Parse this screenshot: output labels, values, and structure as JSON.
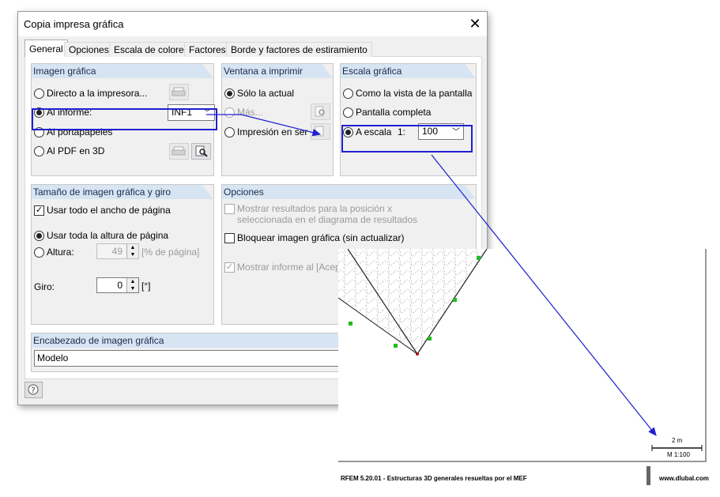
{
  "dialog": {
    "title": "Copia impresa gráfica",
    "tabs": [
      "General",
      "Opciones",
      "Escala de colores",
      "Factores",
      "Borde y factores de estiramiento"
    ],
    "active_tab": "General"
  },
  "imagen_grafica": {
    "header": "Imagen gráfica",
    "options": [
      "Directo a la impresora...",
      "Al informe:",
      "Al portapapeles",
      "Al PDF en 3D"
    ],
    "selected": "Al informe:",
    "report_value": "INF1"
  },
  "ventana": {
    "header": "Ventana a imprimir",
    "options": [
      "Sólo la actual",
      "Más...",
      "Impresión en serie..."
    ],
    "selected": "Sólo la actual"
  },
  "escala": {
    "header": "Escala gráfica",
    "options": [
      "Como la vista de la pantalla",
      "Pantalla completa",
      "A escala"
    ],
    "selected": "A escala",
    "ratio_label": "1:",
    "scale_value": "100"
  },
  "tamano": {
    "header": "Tamaño de imagen gráfica y giro",
    "use_width_label": "Usar todo el ancho de página",
    "use_height_label": "Usar toda la altura de página",
    "height_label": "Altura:",
    "height_value": "49",
    "height_unit": "[% de página]",
    "rotation_label": "Giro:",
    "rotation_value": "0",
    "rotation_unit": "[°]"
  },
  "opciones": {
    "header": "Opciones",
    "show_results_line1": "Mostrar resultados para la posición x",
    "show_results_line2": "seleccionada en el diagrama de resultados",
    "lock_label": "Bloquear imagen gráfica (sin actualizar)",
    "show_report_label": "Mostrar informe al [Aceptar]"
  },
  "encabezado": {
    "header": "Encabezado de imagen gráfica",
    "value": "Modelo"
  },
  "preview": {
    "scale_bar_label": "2 m",
    "scale_text": "M 1:100",
    "footer_left": "RFEM 5.20.01 - Estructuras 3D generales resueltas por el MEF",
    "footer_right": "www.dlubal.com"
  },
  "colors": {
    "highlight": "#1f1fd0",
    "group_header": "#d7e4f2",
    "support_marker": "#22bb22"
  },
  "icons": [
    "close-icon",
    "printer-icon",
    "preview-icon",
    "help-icon"
  ]
}
